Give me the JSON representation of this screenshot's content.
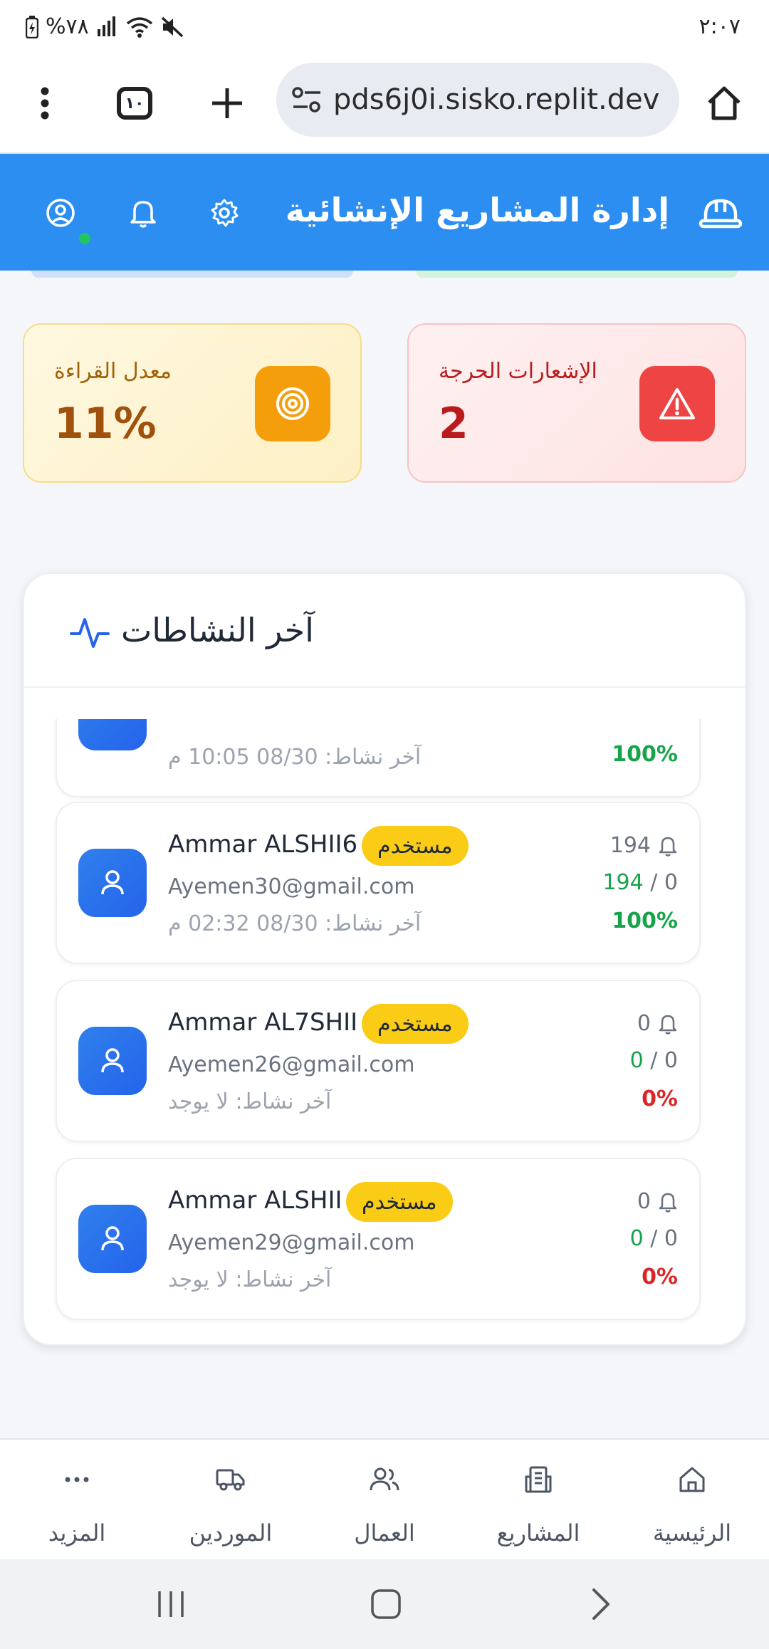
{
  "status_bar": {
    "time": "٢:٠٧",
    "battery": "%٧٨"
  },
  "browser": {
    "tab_count": "١٠",
    "url": "pds6j0i.sisko.replit.dev"
  },
  "app_header": {
    "title": "إدارة المشاريع الإنشائية"
  },
  "stats": {
    "critical": {
      "label": "الإشعارات الحرجة",
      "value": "2"
    },
    "read_rate": {
      "label": "معدل القراءة",
      "value": "11%"
    }
  },
  "activities": {
    "title": "آخر النشاطات",
    "items": [
      {
        "name": "",
        "role": "",
        "email": "",
        "last_activity": "آخر نشاط: 08/30 10:05 م",
        "notifications": "",
        "read": "",
        "sent": "",
        "percent": "100%"
      },
      {
        "name": "Ammar ALSHII6",
        "role": "مستخدم",
        "email": "Ayemen30@gmail.com",
        "last_activity": "آخر نشاط: 08/30 02:32 م",
        "notifications": "194",
        "read": "0",
        "sent": "194",
        "percent": "100%"
      },
      {
        "name": "Ammar AL7SHII",
        "role": "مستخدم",
        "email": "Ayemen26@gmail.com",
        "last_activity": "آخر نشاط: لا يوجد",
        "notifications": "0",
        "read": "0",
        "sent": "0",
        "percent": "0%"
      },
      {
        "name": "Ammar ALSHII",
        "role": "مستخدم",
        "email": "Ayemen29@gmail.com",
        "last_activity": "آخر نشاط: لا يوجد",
        "notifications": "0",
        "read": "0",
        "sent": "0",
        "percent": "0%"
      }
    ]
  },
  "bottom_nav": {
    "home": "الرئيسية",
    "projects": "المشاريع",
    "workers": "العمال",
    "suppliers": "الموردين",
    "more": "المزيد"
  },
  "colors": {
    "header": "#2b8ef0",
    "critical": "#ef4444",
    "rate": "#f59e0b",
    "badge": "#facc15",
    "success": "#16a34a",
    "danger": "#dc2626"
  }
}
